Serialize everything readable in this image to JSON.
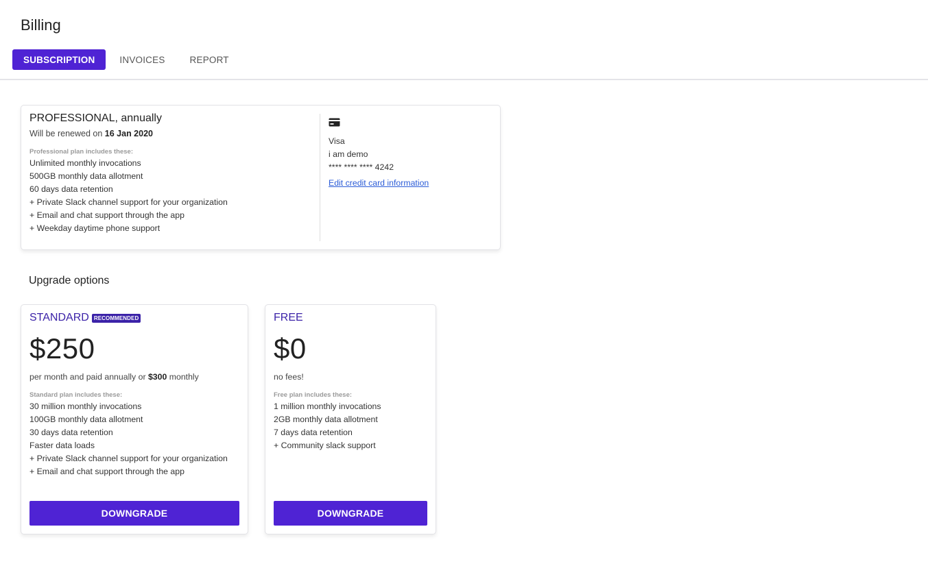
{
  "page": {
    "title": "Billing"
  },
  "tabs": [
    {
      "label": "SUBSCRIPTION",
      "active": true
    },
    {
      "label": "INVOICES",
      "active": false
    },
    {
      "label": "REPORT",
      "active": false
    }
  ],
  "current_plan": {
    "name": "PROFESSIONAL, annually",
    "renew_prefix": "Will be renewed on",
    "renew_date": "16 Jan 2020",
    "includes_title": "Professional plan includes these:",
    "features": [
      "Unlimited monthly invocations",
      "500GB monthly data allotment",
      "60 days data retention",
      "+ Private Slack channel support for your organization",
      "+ Email and chat support through the app",
      "+ Weekday daytime phone support"
    ]
  },
  "payment": {
    "icon": "credit-card-icon",
    "brand": "Visa",
    "holder": "i am demo",
    "number": "**** **** **** 4242",
    "edit_link": "Edit credit card information"
  },
  "upgrade": {
    "title": "Upgrade options",
    "plans": [
      {
        "name": "STANDARD",
        "badge": "RECOMMENDED",
        "price": "$250",
        "note_prefix": "per month and paid annually or",
        "note_bold": "$300",
        "note_suffix": "monthly",
        "includes_title": "Standard plan includes these:",
        "features": [
          "30 million monthly invocations",
          "100GB monthly data allotment",
          "30 days data retention",
          "Faster data loads",
          "+ Private Slack channel support for your organization",
          "+ Email and chat support through the app"
        ],
        "button": "DOWNGRADE"
      },
      {
        "name": "FREE",
        "price": "$0",
        "note": "no fees!",
        "includes_title": "Free plan includes these:",
        "features": [
          "1 million monthly invocations",
          "2GB monthly data allotment",
          "7 days data retention",
          "+ Community slack support"
        ],
        "button": "DOWNGRADE"
      }
    ]
  },
  "colors": {
    "accent": "#4f23d4",
    "plan_label": "#3b22a8",
    "link": "#2a5bd7"
  }
}
